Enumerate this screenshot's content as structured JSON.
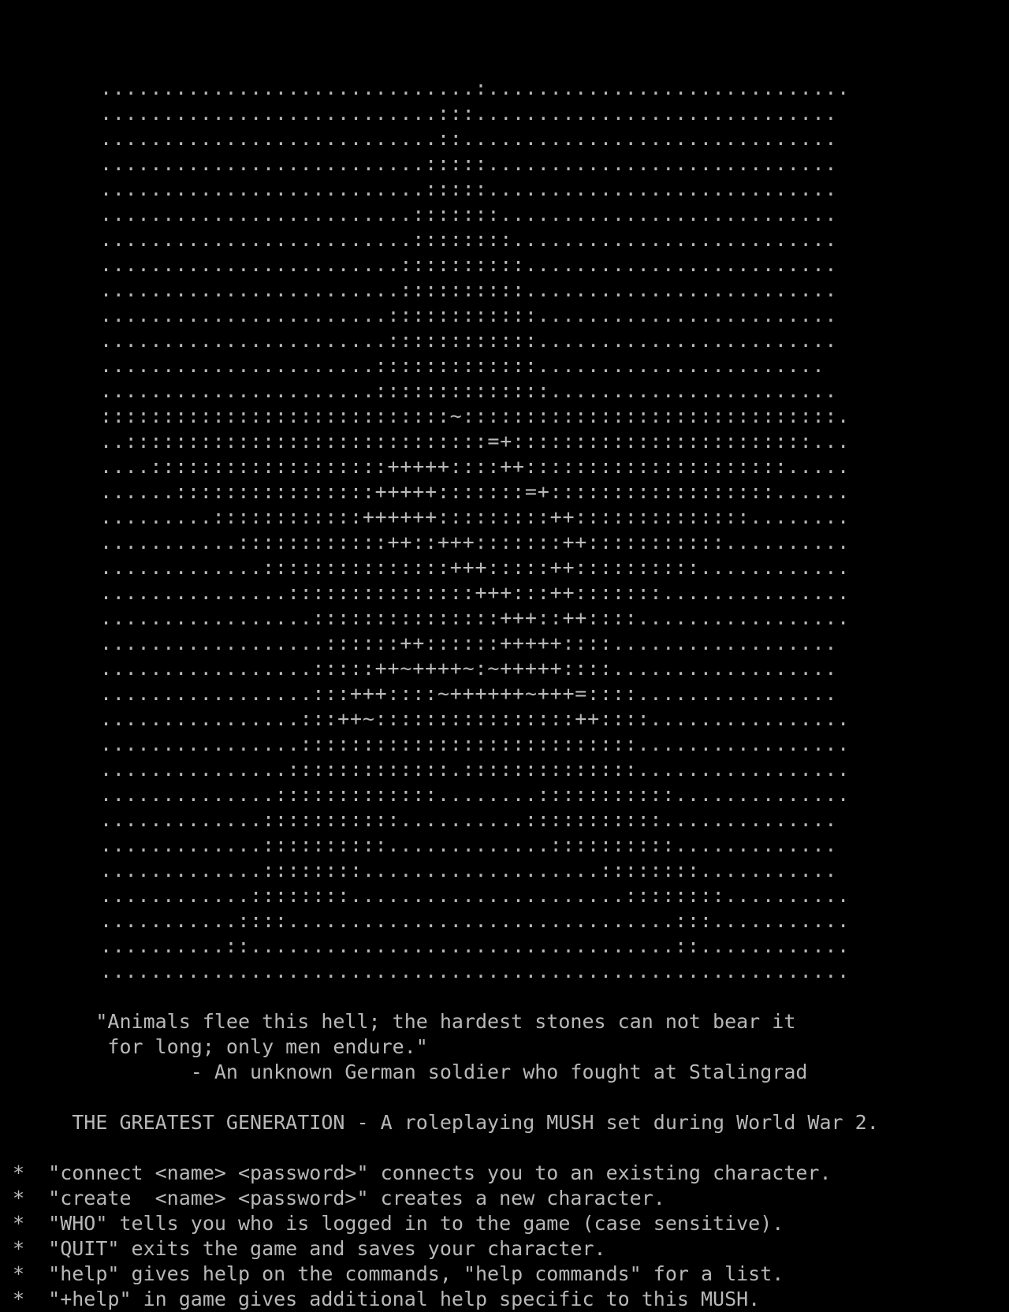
{
  "terminal": {
    "foreground": "#b8b8b8",
    "background": "#000000",
    "lines": [
      "",
      "",
      "",
      "       ..............................:.............................",
      "       ...........................:::.............................",
      "       ...........................::..............................",
      "       ..........................:::::............................",
      "       ..........................:::::............................",
      "       .........................:::::::...........................",
      "       .........................::::::::..........................",
      "       ........................::::::::::.........................",
      "       ........................::::::::::.........................",
      "       .......................::::::::::::........................",
      "       .......................::::::::::::........................",
      "       ......................:::::::::::::.......................",
      "       ......................::::::::::::::.......................",
      "       ::::::::::::::::::::::::::::~::::::::::::::::::::::::::::::.",
      "       ..:::::::::::::::::::::::::::::=+::::::::::::::::::::::::...",
      "       ....:::::::::::::::::::+++++::::++:::::::::::::::::::::.....",
      "       ......::::::::::::::::+++++:::::::=+::::::::::::::::::......",
      "       .........::::::::::::++++++:::::::::++::::::::::::::........",
      "       ...........::::::::::::++::+++:::::::++:::::::::::..........",
      "       .............:::::::::::::::+++:::::++::::::::::............",
      "       ...............:::::::::::::::+++:::++:::::::...............",
      "       .................:::::::::::::::+++::++::::.................",
      "       ..................::::::++::::::+++++::::..................",
      "       .................:::::++~++++~:~+++++::::..................",
      "       .................:::+++::::~++++++~+++=::::................",
      "       ................:::++~::::::::::::::::++::::................",
      "       ................:::::::::::::::::::::::::::.................",
      "       ...............:::::::::::::.::::::::::::::.................",
      "       ..............:::::::::::::........:::::::::::..............",
      "       .............:::::::::::..........:::::::::::..............",
      "       .............::::::::::.............::::::::::.............",
      "       .............::::::::...................::::::::...........",
      "       ............::::::::......................::::::::..........",
      "       ...........::::...............................:::...........",
      "       ..........::..................................::............",
      "       ............................................................",
      "",
      "       \"Animals flee this hell; the hardest stones can not bear it",
      "        for long; only men endure.\"",
      "               - An unknown German soldier who fought at Stalingrad",
      "",
      "     THE GREATEST GENERATION - A roleplaying MUSH set during World War 2.",
      "",
      "*  \"connect <name> <password>\" connects you to an existing character.",
      "*  \"create  <name> <password>\" creates a new character.",
      "*  \"WHO\" tells you who is logged in to the game (case sensitive).",
      "*  \"QUIT\" exits the game and saves your character.",
      "*  \"help\" gives help on the commands, \"help commands\" for a list.",
      "*  \"+help\" in game gives additional help specific to this MUSH."
    ]
  }
}
